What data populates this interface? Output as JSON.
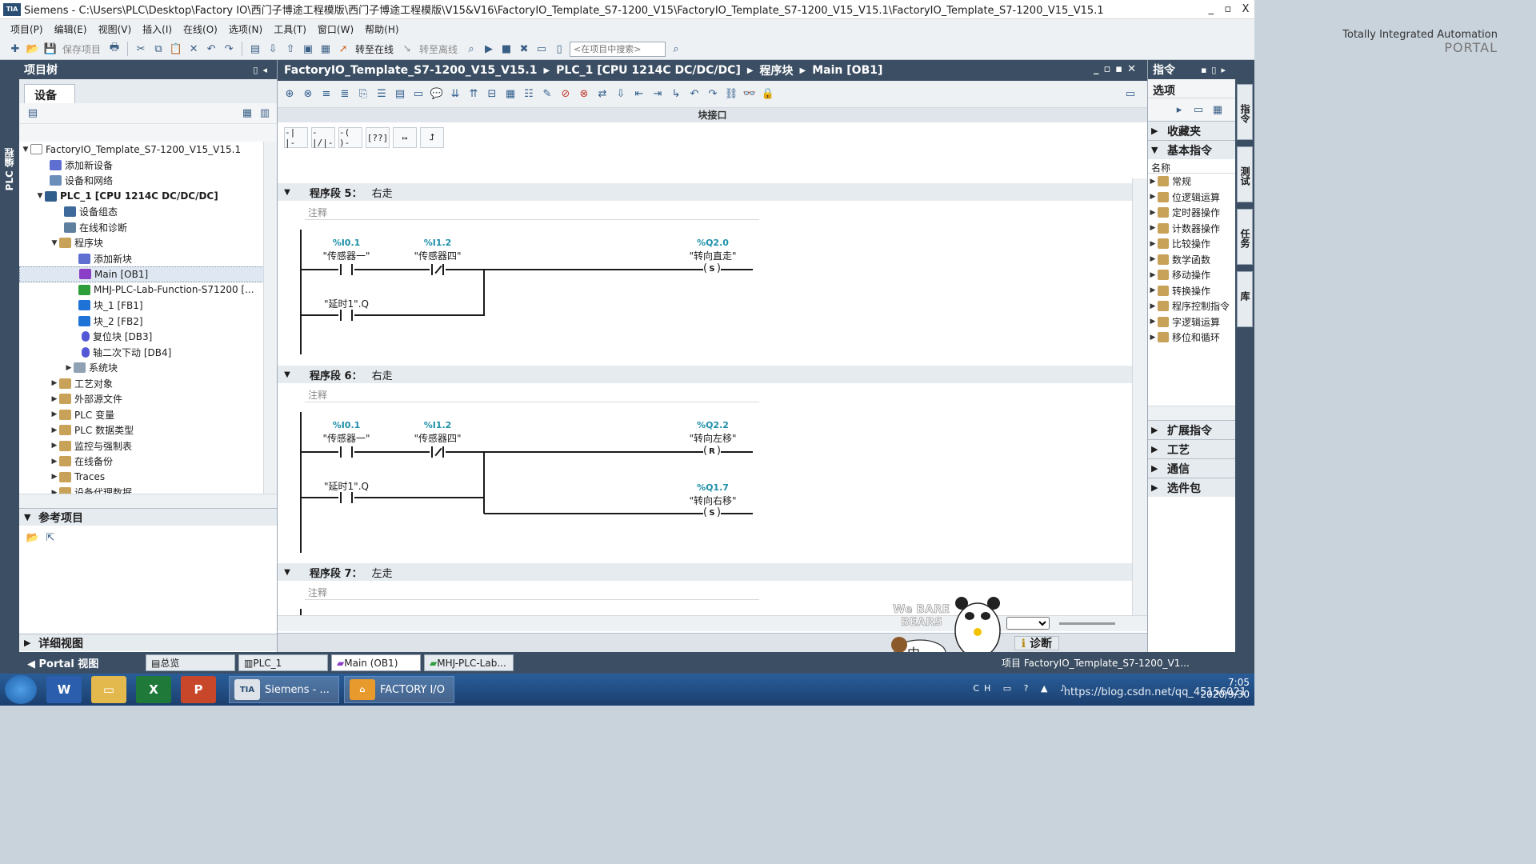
{
  "window": {
    "app_badge": "TIA",
    "title": "Siemens  -  C:\\Users\\PLC\\Desktop\\Factory IO\\西门子博途工程模版\\西门子博途工程模版\\V15&V16\\FactoryIO_Template_S7-1200_V15\\FactoryIO_Template_S7-1200_V15_V15.1\\FactoryIO_Template_S7-1200_V15_V15.1",
    "controls": [
      "_",
      "▫",
      "X"
    ]
  },
  "menu": [
    "项目(P)",
    "编辑(E)",
    "视图(V)",
    "插入(I)",
    "在线(O)",
    "选项(N)",
    "工具(T)",
    "窗口(W)",
    "帮助(H)"
  ],
  "brand": {
    "line1": "Totally Integrated Automation",
    "line2": "PORTAL"
  },
  "toolbar": {
    "save_project": "保存项目",
    "go_online": "转至在线",
    "go_offline": "转至离线",
    "search_placeholder": "<在项目中搜索>"
  },
  "left_strip": {
    "label": "PLC 编程"
  },
  "project_tree": {
    "title": "项目树",
    "tab": "设备",
    "items": [
      {
        "label": "FactoryIO_Template_S7-1200_V15_V15.1",
        "icon": "project-icon"
      },
      {
        "label": "添加新设备",
        "icon": "add-device-icon"
      },
      {
        "label": "设备和网络",
        "icon": "network-icon"
      },
      {
        "label": "PLC_1 [CPU 1214C DC/DC/DC]",
        "icon": "plc-icon"
      },
      {
        "label": "设备组态",
        "icon": "device-config-icon"
      },
      {
        "label": "在线和诊断",
        "icon": "online-diagnostics-icon"
      },
      {
        "label": "程序块",
        "icon": "folder-icon"
      },
      {
        "label": "添加新块",
        "icon": "add-block-icon"
      },
      {
        "label": "Main [OB1]",
        "icon": "ob-icon"
      },
      {
        "label": "MHJ-PLC-Lab-Function-S71200 [...",
        "icon": "fc-icon"
      },
      {
        "label": "块_1 [FB1]",
        "icon": "fb-icon"
      },
      {
        "label": "块_2 [FB2]",
        "icon": "fb-icon"
      },
      {
        "label": "复位块 [DB3]",
        "icon": "db-icon"
      },
      {
        "label": "轴二次下动 [DB4]",
        "icon": "db-icon"
      },
      {
        "label": "系统块",
        "icon": "system-block-icon"
      },
      {
        "label": "工艺对象",
        "icon": "folder-icon"
      },
      {
        "label": "外部源文件",
        "icon": "folder-icon"
      },
      {
        "label": "PLC 变量",
        "icon": "folder-icon"
      },
      {
        "label": "PLC 数据类型",
        "icon": "folder-icon"
      },
      {
        "label": "监控与强制表",
        "icon": "folder-icon"
      },
      {
        "label": "在线备份",
        "icon": "folder-icon"
      },
      {
        "label": "Traces",
        "icon": "folder-icon"
      },
      {
        "label": "设备代理数据",
        "icon": "folder-icon"
      }
    ],
    "reference_projects": "参考项目",
    "details_view": "详细视图"
  },
  "editor": {
    "breadcrumb": [
      "FactoryIO_Template_S7-1200_V15_V15.1",
      "PLC_1 [CPU 1214C DC/DC/DC]",
      "程序块",
      "Main [OB1]"
    ],
    "block_interface": "块接口",
    "networks": [
      {
        "label": "程序段 5：",
        "title": "右走",
        "comment": "注释",
        "contacts": [
          {
            "addr": "%I0.1",
            "name": "\"传感器一\""
          },
          {
            "addr": "%I1.2",
            "name": "\"传感器四\""
          },
          {
            "addr": "",
            "name": "\"延时1\".Q"
          }
        ],
        "coils": [
          {
            "addr": "%Q2.0",
            "name": "\"转向直走\"",
            "type": "S"
          }
        ]
      },
      {
        "label": "程序段 6：",
        "title": "右走",
        "comment": "注释",
        "contacts": [
          {
            "addr": "%I0.1",
            "name": "\"传感器一\""
          },
          {
            "addr": "%I1.2",
            "name": "\"传感器四\""
          },
          {
            "addr": "",
            "name": "\"延时1\".Q"
          }
        ],
        "coils": [
          {
            "addr": "%Q2.2",
            "name": "\"转向左移\"",
            "type": "R"
          },
          {
            "addr": "%Q1.7",
            "name": "\"转向右移\"",
            "type": "S"
          }
        ]
      },
      {
        "label": "程序段 7：",
        "title": "左走",
        "comment": "注释"
      }
    ]
  },
  "inspector": {
    "tabs": [
      "诊断"
    ]
  },
  "task_panel": {
    "title": "指令",
    "options": "选项",
    "sections": [
      "收藏夹",
      "基本指令",
      "扩展指令",
      "工艺",
      "通信",
      "选件包"
    ],
    "name_header": "名称",
    "basic_instructions": [
      "常规",
      "位逻辑运算",
      "定时器操作",
      "计数器操作",
      "比较操作",
      "数学函数",
      "移动操作",
      "转换操作",
      "程序控制指令",
      "字逻辑运算",
      "移位和循环"
    ],
    "side_tabs": [
      "指令",
      "测试",
      "任务",
      "库"
    ]
  },
  "portal_bar": {
    "portal_view": "Portal 视图",
    "open_editors": [
      "总览",
      "PLC_1",
      "Main (OB1)",
      "MHJ-PLC-Lab..."
    ],
    "project_status": "项目 FactoryIO_Template_S7-1200_V1..."
  },
  "taskbar": {
    "windows": [
      "Siemens - ...",
      "FACTORY I/O"
    ],
    "clock_time": "7:05",
    "clock_date": "2020/9/30",
    "watermark": "https://blog.csdn.net/qq_45156021",
    "ime": "CH"
  },
  "watermark_logo": "We BARE BEARS"
}
